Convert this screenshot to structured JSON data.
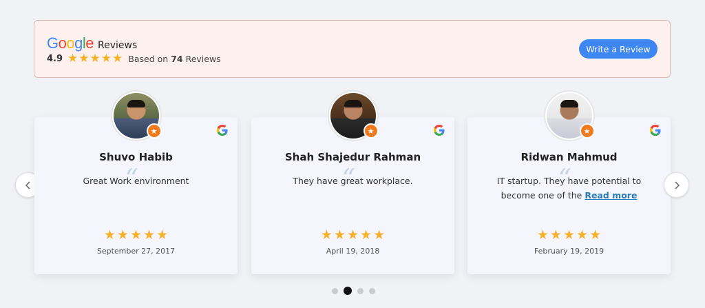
{
  "header": {
    "brand_letters": [
      "G",
      "o",
      "o",
      "g",
      "l",
      "e"
    ],
    "brand_colors": [
      "#4285F4",
      "#EA4335",
      "#FBBC05",
      "#4285F4",
      "#34A853",
      "#EA4335"
    ],
    "reviews_word": "Reviews",
    "rating": "4.9",
    "stars": 5,
    "based_on_prefix": "Based on",
    "review_count": "74",
    "based_on_suffix": "Reviews",
    "write_button": "Write a Review",
    "accent_color": "#3e87f2",
    "star_color": "#f5b12a"
  },
  "reviews": [
    {
      "name": "Shuvo Habib",
      "text": "Great Work environment",
      "read_more": "",
      "stars": 5,
      "date": "September 27, 2017",
      "source_icon": "google-g-icon",
      "avatar": "avatar-photo"
    },
    {
      "name": "Shah Shajedur Rahman",
      "text": "They have great workplace.",
      "read_more": "",
      "stars": 5,
      "date": "April 19, 2018",
      "source_icon": "google-g-icon",
      "avatar": "avatar-photo"
    },
    {
      "name": "Ridwan Mahmud",
      "text": "IT startup. They have potential to become one of the",
      "read_more": "Read more",
      "stars": 5,
      "date": "February 19, 2019",
      "source_icon": "google-g-icon",
      "avatar": "avatar-photo"
    }
  ],
  "carousel": {
    "prev_icon": "chevron-left-icon",
    "next_icon": "chevron-right-icon",
    "page_count": 4,
    "active_page": 2
  }
}
